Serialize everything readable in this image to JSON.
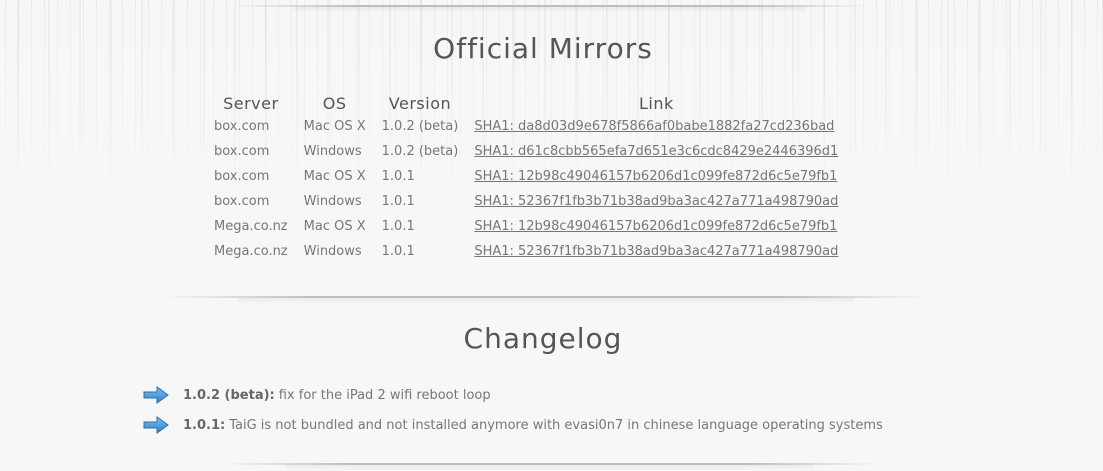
{
  "mirrors": {
    "title": "Official Mirrors",
    "headers": {
      "server": "Server",
      "os": "OS",
      "version": "Version",
      "link": "Link"
    },
    "rows": [
      {
        "server": "box.com",
        "os": "Mac OS X",
        "version": "1.0.2 (beta)",
        "link": "SHA1: da8d03d9e678f5866af0babe1882fa27cd236bad"
      },
      {
        "server": "box.com",
        "os": "Windows",
        "version": "1.0.2 (beta)",
        "link": "SHA1: d61c8cbb565efa7d651e3c6cdc8429e2446396d1"
      },
      {
        "server": "box.com",
        "os": "Mac OS X",
        "version": "1.0.1",
        "link": "SHA1: 12b98c49046157b6206d1c099fe872d6c5e79fb1"
      },
      {
        "server": "box.com",
        "os": "Windows",
        "version": "1.0.1",
        "link": "SHA1: 52367f1fb3b71b38ad9ba3ac427a771a498790ad"
      },
      {
        "server": "Mega.co.nz",
        "os": "Mac OS X",
        "version": "1.0.1",
        "link": "SHA1: 12b98c49046157b6206d1c099fe872d6c5e79fb1"
      },
      {
        "server": "Mega.co.nz",
        "os": "Windows",
        "version": "1.0.1",
        "link": "SHA1: 52367f1fb3b71b38ad9ba3ac427a771a498790ad"
      }
    ]
  },
  "changelog": {
    "title": "Changelog",
    "icon": "arrow-right-icon",
    "accent_color": "#3a8fd8",
    "items": [
      {
        "version": "1.0.2 (beta):",
        "text": "fix for the iPad 2 wifi reboot loop"
      },
      {
        "version": "1.0.1:",
        "text": "TaiG is not bundled and not installed anymore with evasi0n7 in chinese language operating systems"
      }
    ]
  }
}
